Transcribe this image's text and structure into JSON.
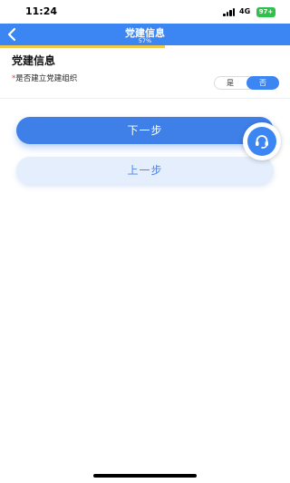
{
  "status_bar": {
    "time": "11:24",
    "network": "4G",
    "battery": "97+"
  },
  "nav": {
    "title": "党建信息",
    "progress_text": "57%",
    "progress_value": 0.57,
    "back_icon": "chevron-left-icon"
  },
  "section": {
    "title": "党建信息"
  },
  "field": {
    "required_mark": "*",
    "label": "是否建立党建组织",
    "options": [
      "是",
      "否"
    ],
    "selected": "否"
  },
  "buttons": {
    "next_label": "下一步",
    "prev_label": "上一步"
  },
  "fab": {
    "icon": "customer-service-headset-icon"
  },
  "colors": {
    "primary": "#3b86f2",
    "progress": "#f3c748",
    "required": "#e23b3b",
    "secondary_button_bg": "#e4eefc"
  }
}
